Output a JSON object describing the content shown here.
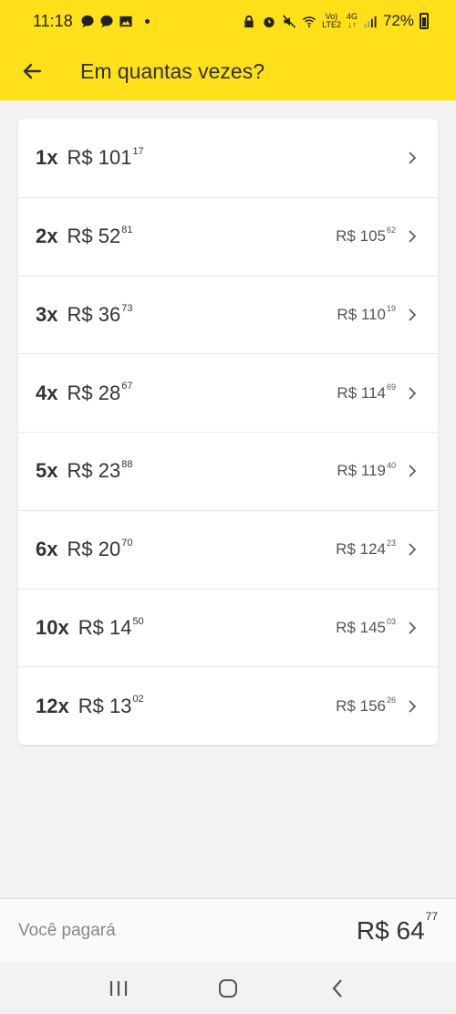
{
  "status_bar": {
    "time": "11:18",
    "network_top": "Vo)",
    "network_bottom": "LTE2",
    "gen_top": "4G",
    "gen_bottom": "↓↑",
    "battery": "72%"
  },
  "header": {
    "title": "Em quantas vezes?"
  },
  "installments": [
    {
      "qty": "1x",
      "amount": "R$ 101",
      "amount_cents": "17",
      "total": "",
      "total_cents": ""
    },
    {
      "qty": "2x",
      "amount": "R$ 52",
      "amount_cents": "81",
      "total": "R$ 105",
      "total_cents": "62"
    },
    {
      "qty": "3x",
      "amount": "R$ 36",
      "amount_cents": "73",
      "total": "R$ 110",
      "total_cents": "19"
    },
    {
      "qty": "4x",
      "amount": "R$ 28",
      "amount_cents": "67",
      "total": "R$ 114",
      "total_cents": "69"
    },
    {
      "qty": "5x",
      "amount": "R$ 23",
      "amount_cents": "88",
      "total": "R$ 119",
      "total_cents": "40"
    },
    {
      "qty": "6x",
      "amount": "R$ 20",
      "amount_cents": "70",
      "total": "R$ 124",
      "total_cents": "23"
    },
    {
      "qty": "10x",
      "amount": "R$ 14",
      "amount_cents": "50",
      "total": "R$ 145",
      "total_cents": "03"
    },
    {
      "qty": "12x",
      "amount": "R$ 13",
      "amount_cents": "02",
      "total": "R$ 156",
      "total_cents": "26"
    }
  ],
  "footer": {
    "label": "Você pagará",
    "value": "R$ 64",
    "value_cents": "77"
  },
  "colors": {
    "brand_yellow": "#ffe01a",
    "background": "#f2f2f2"
  }
}
